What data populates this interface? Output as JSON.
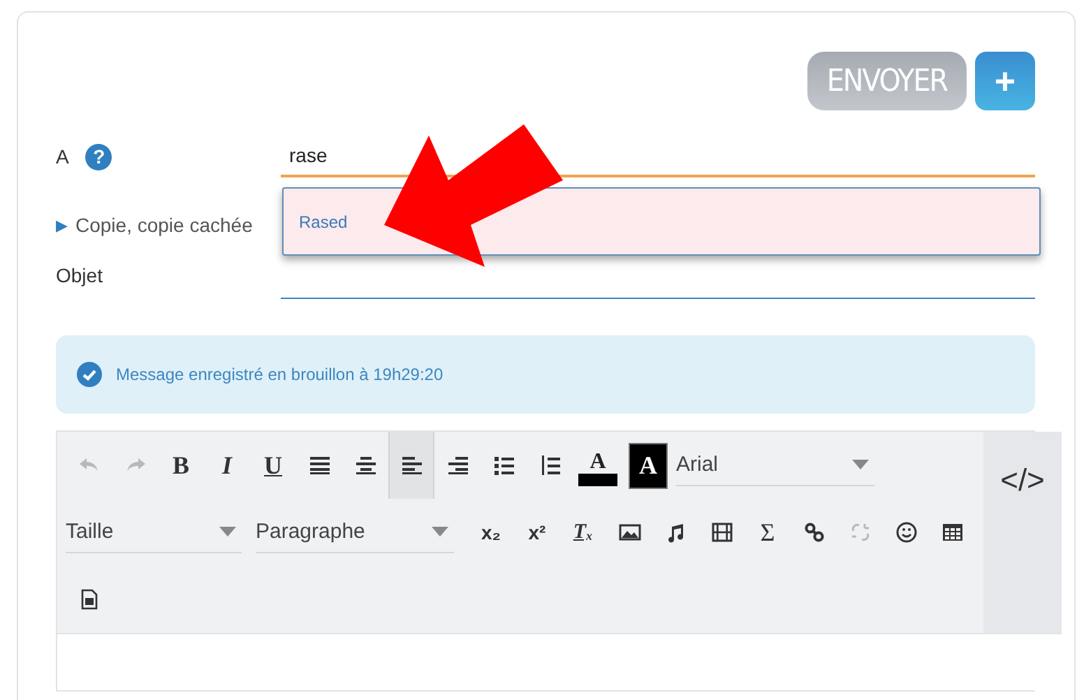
{
  "actions": {
    "send": "ENVOYER",
    "add": "+"
  },
  "to": {
    "label": "A",
    "help": "?",
    "value": "rase"
  },
  "suggestions": [
    {
      "label": "Rased",
      "selected": true
    }
  ],
  "cc": {
    "toggle": "▶",
    "label": "Copie, copie cachée",
    "expanded": false
  },
  "subject": {
    "label": "Objet"
  },
  "notice": {
    "text": "Message enregistré en brouillon à 19h29:20"
  },
  "editor": {
    "source": "</>",
    "first_line": [
      {
        "kind": "undo",
        "disabled": true,
        "selected": false
      },
      {
        "kind": "redo",
        "disabled": true,
        "selected": false
      },
      {
        "kind": "bold",
        "text": "B",
        "disabled": false,
        "selected": false
      },
      {
        "kind": "italic",
        "text": "I",
        "disabled": false,
        "selected": false
      },
      {
        "kind": "underline",
        "text": "U",
        "disabled": false,
        "selected": false
      },
      {
        "kind": "justify",
        "disabled": false,
        "selected": false
      },
      {
        "kind": "center",
        "disabled": false,
        "selected": false
      },
      {
        "kind": "left",
        "disabled": false,
        "selected": true
      },
      {
        "kind": "right",
        "disabled": false,
        "selected": false
      },
      {
        "kind": "bullets",
        "disabled": false,
        "selected": false
      },
      {
        "kind": "numbers",
        "disabled": false,
        "selected": false
      },
      {
        "kind": "text-color",
        "text": "A",
        "disabled": false,
        "selected": false
      },
      {
        "kind": "back-color",
        "text": "A",
        "disabled": false,
        "selected": false
      },
      {
        "kind": "select",
        "text": "Arial",
        "disabled": false,
        "selected": false
      }
    ],
    "second_line": [
      {
        "kind": "select",
        "text": "Taille",
        "disabled": false,
        "selected": false
      },
      {
        "kind": "select",
        "text": "Paragraphe",
        "disabled": false,
        "selected": false
      },
      {
        "kind": "sub",
        "text": "x₂",
        "disabled": false,
        "selected": false
      },
      {
        "kind": "sup",
        "text": "x²",
        "disabled": false,
        "selected": false
      },
      {
        "kind": "clear",
        "text": "Tₓ",
        "disabled": false,
        "selected": false
      },
      {
        "kind": "image",
        "disabled": false,
        "selected": false
      },
      {
        "kind": "music",
        "disabled": false,
        "selected": false
      },
      {
        "kind": "film",
        "disabled": false,
        "selected": false
      },
      {
        "kind": "sigma",
        "text": "Σ",
        "disabled": false,
        "selected": false
      },
      {
        "kind": "link",
        "disabled": false,
        "selected": false
      },
      {
        "kind": "unlink",
        "disabled": true,
        "selected": false
      },
      {
        "kind": "smiley",
        "disabled": false,
        "selected": false
      },
      {
        "kind": "table",
        "disabled": false,
        "selected": false
      }
    ],
    "third_line": [
      {
        "kind": "document",
        "disabled": false,
        "selected": false
      }
    ]
  }
}
